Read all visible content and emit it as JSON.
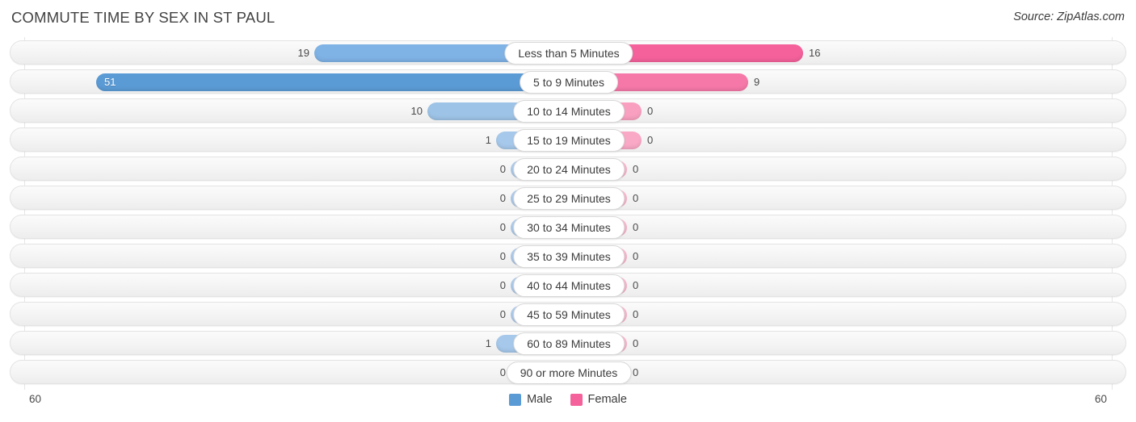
{
  "header": {
    "title": "COMMUTE TIME BY SEX IN ST PAUL",
    "source": "Source: ZipAtlas.com"
  },
  "axis": {
    "left_label": "60",
    "right_label": "60"
  },
  "legend": {
    "items": [
      {
        "label": "Male",
        "color": "#5b9bd5"
      },
      {
        "label": "Female",
        "color": "#f4619b"
      }
    ]
  },
  "colors": {
    "male_strong": "#5b9bd5",
    "male_light": "#9dc3e6",
    "male_pale": "#aecbeb",
    "female_strong": "#f4619b",
    "female_mid": "#f578a8",
    "female_light": "#f9a0c0",
    "female_pale": "#f9b6cc",
    "track": "#f4f4f4",
    "grid": "#e6e6e6"
  },
  "chart_data": {
    "type": "bar",
    "orientation": "horizontal-diverging",
    "title": "COMMUTE TIME BY SEX IN ST PAUL",
    "xlabel": "",
    "ylabel": "",
    "xlim": [
      60,
      60
    ],
    "grid": true,
    "legend_position": "bottom-center",
    "categories": [
      "Less than 5 Minutes",
      "5 to 9 Minutes",
      "10 to 14 Minutes",
      "15 to 19 Minutes",
      "20 to 24 Minutes",
      "25 to 29 Minutes",
      "30 to 34 Minutes",
      "35 to 39 Minutes",
      "40 to 44 Minutes",
      "45 to 59 Minutes",
      "60 to 89 Minutes",
      "90 or more Minutes"
    ],
    "series": [
      {
        "name": "Male",
        "values": [
          19,
          51,
          10,
          1,
          0,
          0,
          0,
          0,
          0,
          0,
          1,
          0
        ]
      },
      {
        "name": "Female",
        "values": [
          16,
          9,
          0,
          0,
          0,
          0,
          0,
          0,
          0,
          0,
          0,
          0
        ]
      }
    ]
  },
  "rows": [
    {
      "label": "Less than 5 Minutes",
      "male": "19",
      "female": "16",
      "male_w": 315,
      "female_w": 290,
      "male_color": "#7fb2e5",
      "female_color": "#f4619b",
      "male_inside": false,
      "female_inside": false
    },
    {
      "label": "5 to 9 Minutes",
      "male": "51",
      "female": "9",
      "male_w": 585,
      "female_w": 222,
      "male_color": "#5b9bd5",
      "female_color": "#f578a8",
      "male_inside": true,
      "female_inside": false
    },
    {
      "label": "10 to 14 Minutes",
      "male": "10",
      "female": "0",
      "male_w": 175,
      "female_w": 90,
      "male_color": "#9dc3e6",
      "female_color": "#f9a0c0",
      "male_inside": false,
      "female_inside": false
    },
    {
      "label": "15 to 19 Minutes",
      "male": "1",
      "female": "0",
      "male_w": 90,
      "female_w": 90,
      "male_color": "#a6c8ea",
      "female_color": "#f9a8c5",
      "male_inside": false,
      "female_inside": false
    },
    {
      "label": "20 to 24 Minutes",
      "male": "0",
      "female": "0",
      "male_w": 72,
      "female_w": 72,
      "male_color": "#aecbeb",
      "female_color": "#f9b6cc",
      "male_inside": false,
      "female_inside": false
    },
    {
      "label": "25 to 29 Minutes",
      "male": "0",
      "female": "0",
      "male_w": 72,
      "female_w": 72,
      "male_color": "#aecbeb",
      "female_color": "#f9b6cc",
      "male_inside": false,
      "female_inside": false
    },
    {
      "label": "30 to 34 Minutes",
      "male": "0",
      "female": "0",
      "male_w": 72,
      "female_w": 72,
      "male_color": "#aecbeb",
      "female_color": "#f9b6cc",
      "male_inside": false,
      "female_inside": false
    },
    {
      "label": "35 to 39 Minutes",
      "male": "0",
      "female": "0",
      "male_w": 72,
      "female_w": 72,
      "male_color": "#aecbeb",
      "female_color": "#f9b6cc",
      "male_inside": false,
      "female_inside": false
    },
    {
      "label": "40 to 44 Minutes",
      "male": "0",
      "female": "0",
      "male_w": 72,
      "female_w": 72,
      "male_color": "#aecbeb",
      "female_color": "#f9b6cc",
      "male_inside": false,
      "female_inside": false
    },
    {
      "label": "45 to 59 Minutes",
      "male": "0",
      "female": "0",
      "male_w": 72,
      "female_w": 72,
      "male_color": "#aecbeb",
      "female_color": "#f9b6cc",
      "male_inside": false,
      "female_inside": false
    },
    {
      "label": "60 to 89 Minutes",
      "male": "1",
      "female": "0",
      "male_w": 90,
      "female_w": 72,
      "male_color": "#a6c8ea",
      "female_color": "#f9b6cc",
      "male_inside": false,
      "female_inside": false
    },
    {
      "label": "90 or more Minutes",
      "male": "0",
      "female": "0",
      "male_w": 72,
      "female_w": 72,
      "male_color": "#aecbeb",
      "female_color": "#f9b6cc",
      "male_inside": false,
      "female_inside": false
    }
  ]
}
